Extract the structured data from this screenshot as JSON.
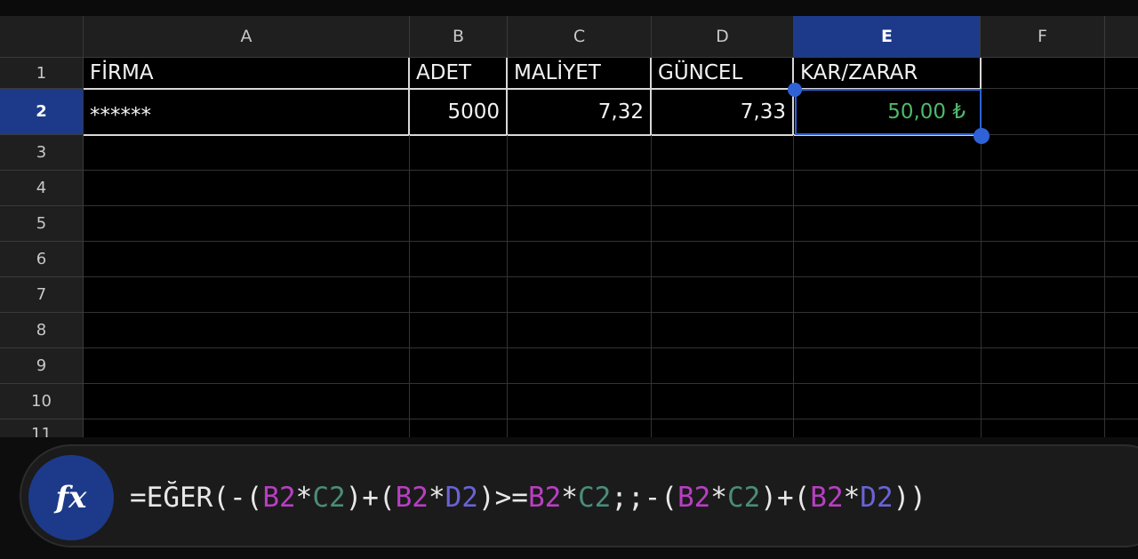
{
  "columns": [
    "A",
    "B",
    "C",
    "D",
    "E",
    "F"
  ],
  "active_column": "E",
  "rows": [
    "1",
    "2",
    "3",
    "4",
    "5",
    "6",
    "7",
    "8",
    "9",
    "10",
    "11"
  ],
  "active_row": "2",
  "table": {
    "headers": [
      "FİRMA",
      "ADET",
      "MALİYET",
      "GÜNCEL",
      "KAR/ZARAR"
    ],
    "row2": {
      "firma": "******",
      "adet": "5000",
      "maliyet": "7,32",
      "guncel": "7,33",
      "kar_zarar": "50,00 ₺"
    }
  },
  "formula_bar": {
    "fx_label": "fx",
    "formula_text": "=EĞER(-(B2*C2)+(B2*D2)>=B2*C2;;-(B2*C2)+(B2*D2))",
    "tokens": [
      {
        "t": "=EĞER(-(",
        "c": "#e8e8e8"
      },
      {
        "t": "B2",
        "c": "#b83fc2"
      },
      {
        "t": "*",
        "c": "#e8e8e8"
      },
      {
        "t": "C2",
        "c": "#4b8c7a"
      },
      {
        "t": ")+(",
        "c": "#e8e8e8"
      },
      {
        "t": "B2",
        "c": "#b83fc2"
      },
      {
        "t": "*",
        "c": "#e8e8e8"
      },
      {
        "t": "D2",
        "c": "#6a63d6"
      },
      {
        "t": ")>=",
        "c": "#e8e8e8"
      },
      {
        "t": "B2",
        "c": "#b83fc2"
      },
      {
        "t": "*",
        "c": "#e8e8e8"
      },
      {
        "t": "C2",
        "c": "#4b8c7a"
      },
      {
        "t": ";;-(",
        "c": "#e8e8e8"
      },
      {
        "t": "B2",
        "c": "#b83fc2"
      },
      {
        "t": "*",
        "c": "#e8e8e8"
      },
      {
        "t": "C2",
        "c": "#4b8c7a"
      },
      {
        "t": ")+(",
        "c": "#e8e8e8"
      },
      {
        "t": "B2",
        "c": "#b83fc2"
      },
      {
        "t": "*",
        "c": "#e8e8e8"
      },
      {
        "t": "D2",
        "c": "#6a63d6"
      },
      {
        "t": "))",
        "c": "#e8e8e8"
      }
    ]
  },
  "colors": {
    "accent": "#1d3a8a",
    "selection": "#2f62d6",
    "positive_value": "#4fb868"
  }
}
